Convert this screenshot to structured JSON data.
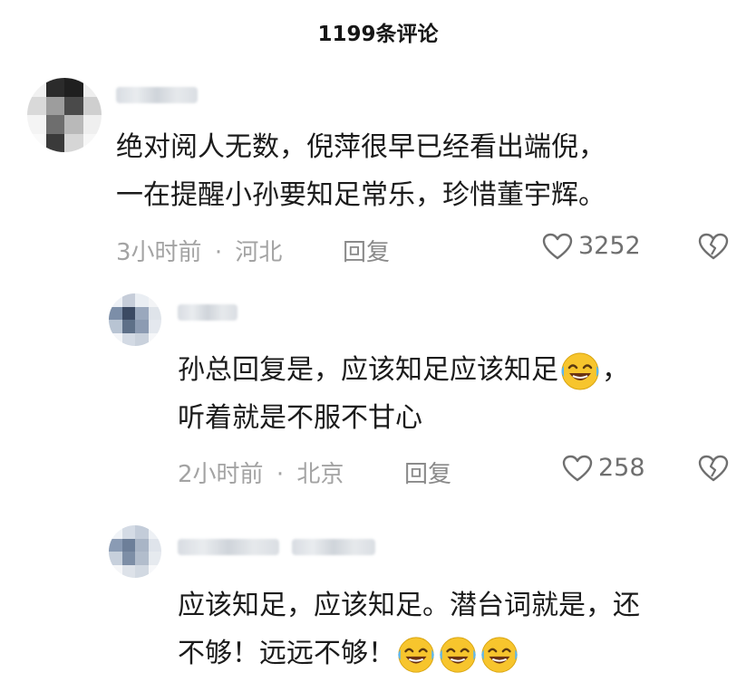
{
  "header": {
    "title": "1199条评论"
  },
  "comments": [
    {
      "content_lines": [
        "绝对阅人无数，倪萍很早已经看出端倪，",
        "一在提醒小孙要知足常乐，珍惜董宇辉。"
      ],
      "time": "3小时前",
      "location": "河北",
      "reply_label": "回复",
      "likes": "3252"
    },
    {
      "content_lines": [
        "孙总回复是，应该知足应该知足",
        "，",
        "听着就是不服不甘心"
      ],
      "time": "2小时前",
      "location": "北京",
      "reply_label": "回复",
      "likes": "258"
    },
    {
      "content_lines": [
        "应该知足，应该知足。潜台词就是，还",
        "不够！远远不够！"
      ]
    }
  ],
  "meta_separator": "·",
  "icons": {
    "like": "heart-outline-icon",
    "dislike": "broken-heart-icon",
    "emoji": "rolling-on-floor-laughing-emoji"
  },
  "colors": {
    "meta": "#a3a3a3",
    "text": "#1b1b1b",
    "emoji": "#f7c52d"
  }
}
